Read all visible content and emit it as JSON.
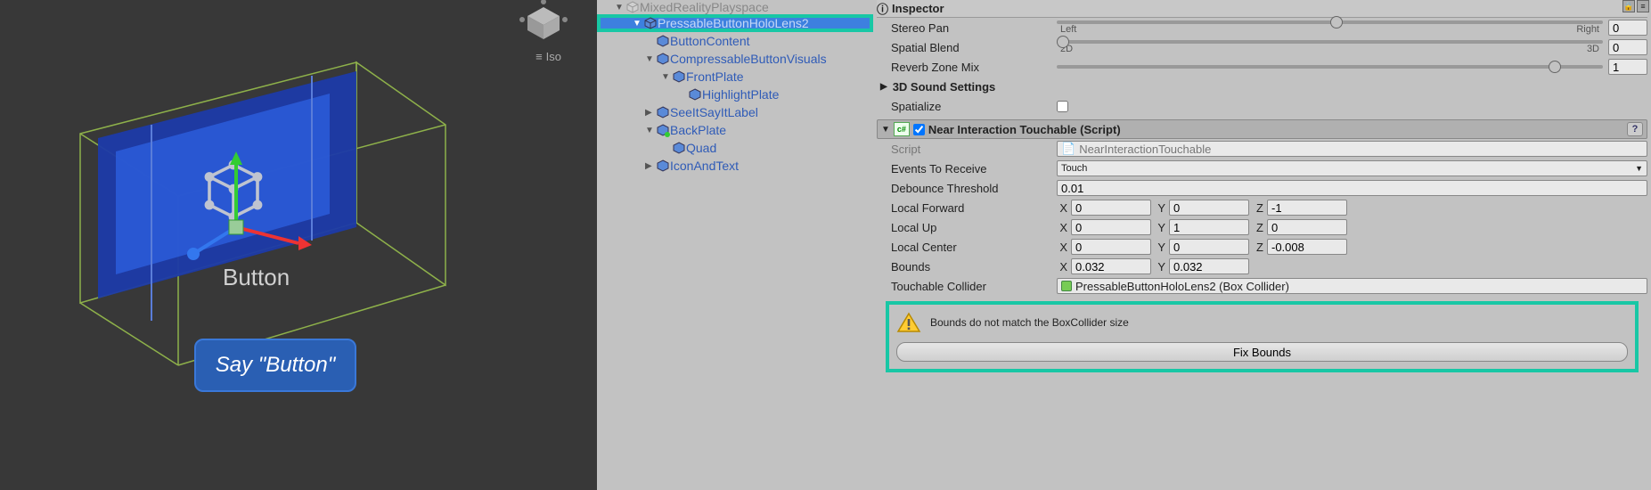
{
  "scene": {
    "persp_label": "Iso",
    "button_caption": "Button",
    "say_label": "Say \"Button\""
  },
  "hierarchy": {
    "items": [
      {
        "label": "MixedRealityPlayspace",
        "indent": 1,
        "expanded": true,
        "selected": false,
        "cut": true
      },
      {
        "label": "PressableButtonHoloLens2",
        "indent": 2,
        "expanded": true,
        "selected": true
      },
      {
        "label": "ButtonContent",
        "indent": 3,
        "expanded": false,
        "selected": false
      },
      {
        "label": "CompressableButtonVisuals",
        "indent": 3,
        "expanded": true,
        "selected": false
      },
      {
        "label": "FrontPlate",
        "indent": 4,
        "expanded": true,
        "selected": false
      },
      {
        "label": "HighlightPlate",
        "indent": 5,
        "expanded": false,
        "selected": false,
        "noarrow": true
      },
      {
        "label": "SeeItSayItLabel",
        "indent": 3,
        "expanded": false,
        "selected": false
      },
      {
        "label": "BackPlate",
        "indent": 3,
        "expanded": true,
        "selected": false,
        "prefab": true
      },
      {
        "label": "Quad",
        "indent": 4,
        "expanded": false,
        "selected": false,
        "noarrow": true
      },
      {
        "label": "IconAndText",
        "indent": 3,
        "expanded": false,
        "selected": false
      }
    ]
  },
  "inspector": {
    "title": "Inspector",
    "stereo_pan": {
      "label": "Stereo Pan",
      "left": "Left",
      "right": "Right",
      "value_pos": 50,
      "value": "0"
    },
    "spatial_blend": {
      "label": "Spatial Blend",
      "left": "2D",
      "right": "3D",
      "value_pos": 0,
      "value": "0"
    },
    "reverb": {
      "label": "Reverb Zone Mix",
      "value_pos": 90,
      "value": "1"
    },
    "sound3d": "3D Sound Settings",
    "spatialize": "Spatialize",
    "component": {
      "name": "Near Interaction Touchable (Script)",
      "script_label": "Script",
      "script_value": "NearInteractionTouchable",
      "events_label": "Events To Receive",
      "events_value": "Touch",
      "debounce_label": "Debounce Threshold",
      "debounce_value": "0.01",
      "local_forward_label": "Local Forward",
      "local_forward": {
        "x": "0",
        "y": "0",
        "z": "-1"
      },
      "local_up_label": "Local Up",
      "local_up": {
        "x": "0",
        "y": "1",
        "z": "0"
      },
      "local_center_label": "Local Center",
      "local_center": {
        "x": "0",
        "y": "0",
        "z": "-0.008"
      },
      "bounds_label": "Bounds",
      "bounds": {
        "x": "0.032",
        "y": "0.032"
      },
      "collider_label": "Touchable Collider",
      "collider_value": "PressableButtonHoloLens2 (Box Collider)",
      "warning": "Bounds do not match the BoxCollider size",
      "fix_button": "Fix Bounds"
    }
  }
}
